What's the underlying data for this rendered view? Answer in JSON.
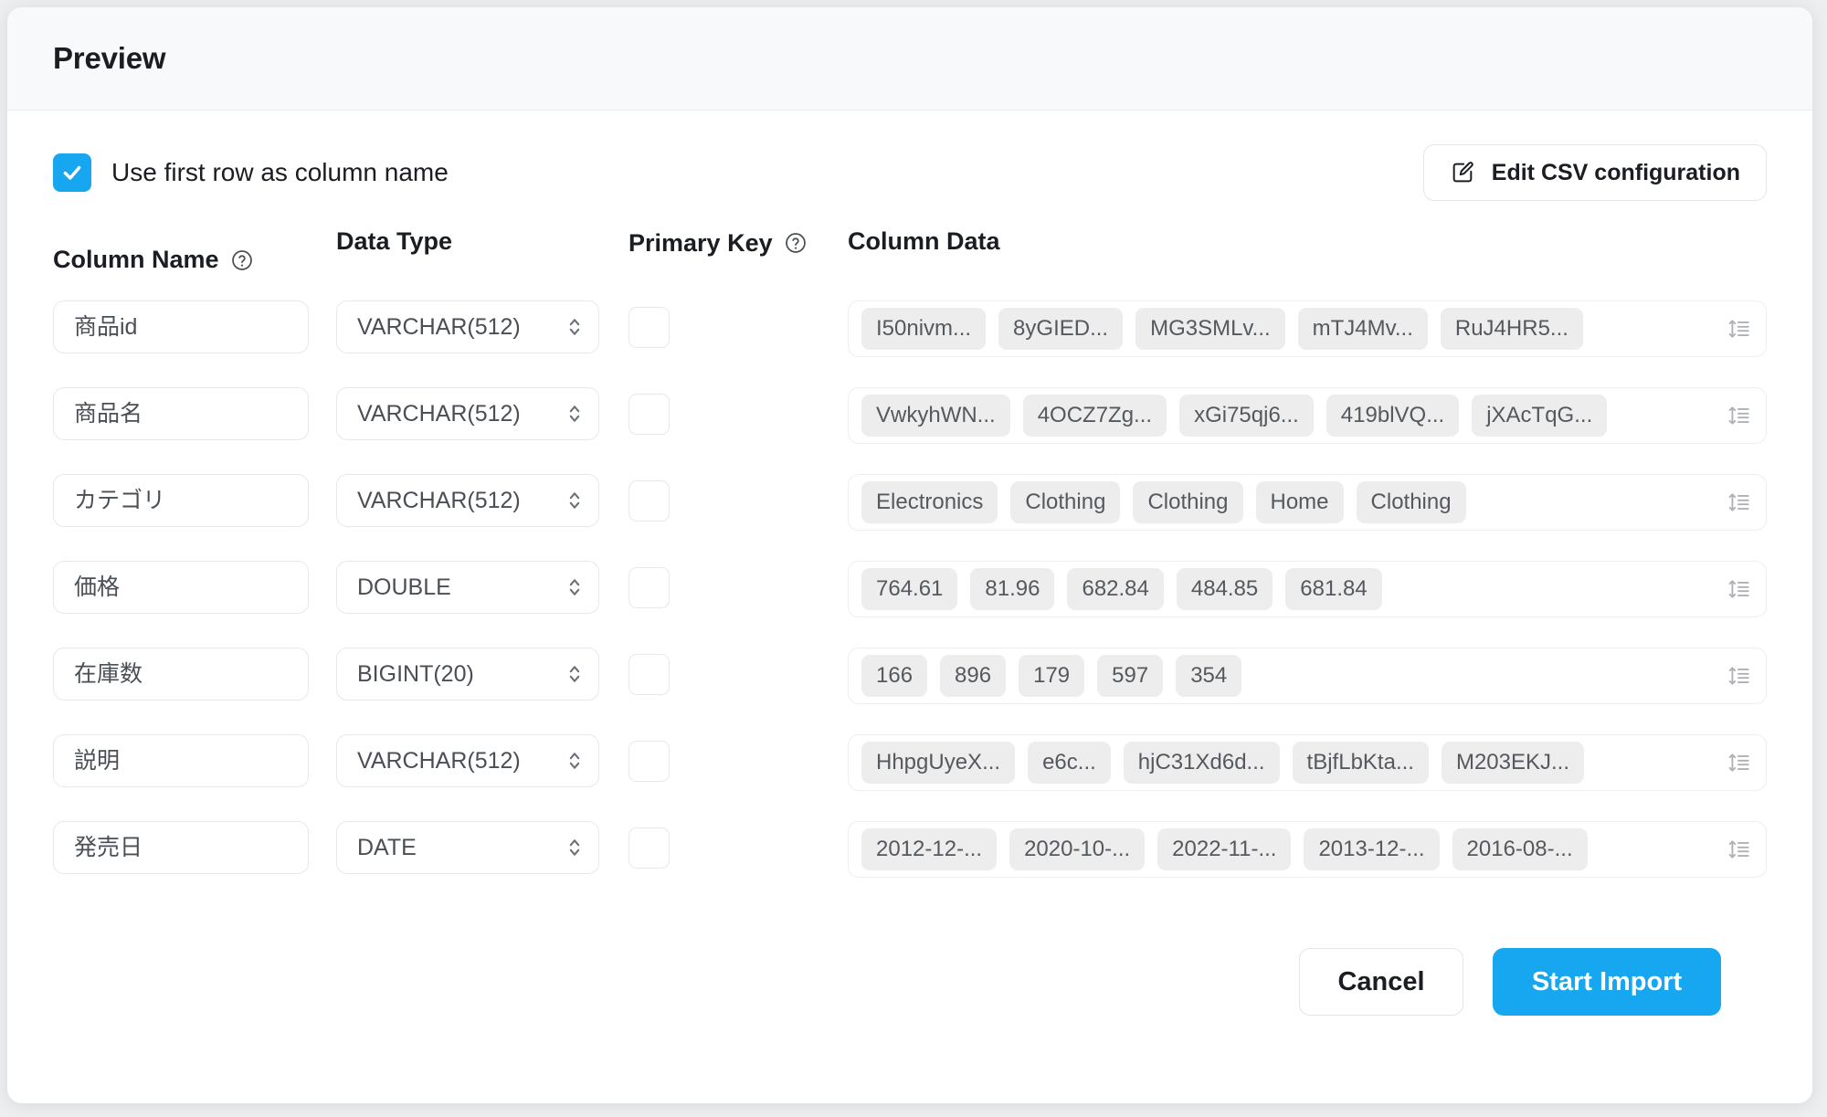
{
  "modal": {
    "title": "Preview"
  },
  "options": {
    "use_first_row_label": "Use first row as column name",
    "use_first_row_checked": true,
    "edit_csv_button": "Edit CSV configuration"
  },
  "table": {
    "headers": {
      "column_name": "Column Name",
      "data_type": "Data Type",
      "primary_key": "Primary Key",
      "column_data": "Column Data"
    },
    "rows": [
      {
        "column_name": "商品id",
        "data_type": "VARCHAR(512)",
        "primary_key": false,
        "column_data": [
          "I50nivm...",
          "8yGIED...",
          "MG3SMLv...",
          "mTJ4Mv...",
          "RuJ4HR5..."
        ]
      },
      {
        "column_name": "商品名",
        "data_type": "VARCHAR(512)",
        "primary_key": false,
        "column_data": [
          "VwkyhWN...",
          "4OCZ7Zg...",
          "xGi75qj6...",
          "419blVQ...",
          "jXAcTqG..."
        ]
      },
      {
        "column_name": "カテゴリ",
        "data_type": "VARCHAR(512)",
        "primary_key": false,
        "column_data": [
          "Electronics",
          "Clothing",
          "Clothing",
          "Home",
          "Clothing"
        ]
      },
      {
        "column_name": "価格",
        "data_type": "DOUBLE",
        "primary_key": false,
        "column_data": [
          "764.61",
          "81.96",
          "682.84",
          "484.85",
          "681.84"
        ]
      },
      {
        "column_name": "在庫数",
        "data_type": "BIGINT(20)",
        "primary_key": false,
        "column_data": [
          "166",
          "896",
          "179",
          "597",
          "354"
        ]
      },
      {
        "column_name": "説明",
        "data_type": "VARCHAR(512)",
        "primary_key": false,
        "column_data": [
          "HhpgUyeX...",
          "e6c...",
          "hjC31Xd6d...",
          "tBjfLbKta...",
          "M203EKJ..."
        ]
      },
      {
        "column_name": "発売日",
        "data_type": "DATE",
        "primary_key": false,
        "column_data": [
          "2012-12-...",
          "2020-10-...",
          "2022-11-...",
          "2013-12-...",
          "2016-08-..."
        ]
      }
    ]
  },
  "footer": {
    "cancel_label": "Cancel",
    "start_import_label": "Start Import"
  },
  "icons": {
    "edit": "edit-square-pencil-icon",
    "help": "question-mark-circle-icon",
    "select_chevrons": "chevron-up-down-icon",
    "expand_rows": "expand-rows-icon",
    "checkmark": "checkmark-icon"
  },
  "colors": {
    "accent": "#16a7f0",
    "header_bg": "#f8f9fa",
    "chip_bg": "#ededee",
    "border": "#e6e8ea",
    "text": "#1a1d21"
  }
}
